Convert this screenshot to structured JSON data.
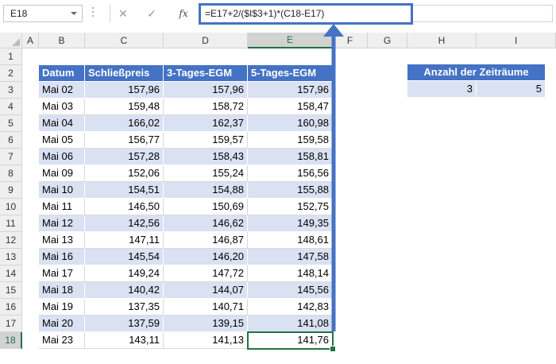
{
  "namebox": {
    "value": "E18"
  },
  "formula_bar": {
    "cancel_icon": "✕",
    "enter_icon": "✓",
    "fx_label": "fx",
    "formula": "=E17+2/($I$3+1)*(C18-E17)"
  },
  "columns": [
    "A",
    "B",
    "C",
    "D",
    "E",
    "F",
    "G",
    "H",
    "I"
  ],
  "rows": [
    "1",
    "2",
    "3",
    "4",
    "5",
    "6",
    "7",
    "8",
    "9",
    "10",
    "11",
    "12",
    "13",
    "14",
    "15",
    "16",
    "17",
    "18"
  ],
  "table": {
    "headers": [
      "Datum",
      "Schließpreis",
      "3-Tages-EGM",
      "5-Tages-EGM"
    ],
    "rows": [
      [
        "Mai 02",
        "157,96",
        "157,96",
        "157,96"
      ],
      [
        "Mai 03",
        "159,48",
        "158,72",
        "158,47"
      ],
      [
        "Mai 04",
        "166,02",
        "162,37",
        "160,98"
      ],
      [
        "Mai 05",
        "156,77",
        "159,57",
        "159,58"
      ],
      [
        "Mai 06",
        "157,28",
        "158,43",
        "158,81"
      ],
      [
        "Mai 09",
        "152,06",
        "155,24",
        "156,56"
      ],
      [
        "Mai 10",
        "154,51",
        "154,88",
        "155,88"
      ],
      [
        "Mai 11",
        "146,50",
        "150,69",
        "152,75"
      ],
      [
        "Mai 12",
        "142,56",
        "146,62",
        "149,35"
      ],
      [
        "Mai 13",
        "147,11",
        "146,87",
        "148,61"
      ],
      [
        "Mai 16",
        "145,54",
        "146,20",
        "147,58"
      ],
      [
        "Mai 17",
        "149,24",
        "147,72",
        "148,14"
      ],
      [
        "Mai 18",
        "140,42",
        "144,07",
        "145,56"
      ],
      [
        "Mai 19",
        "137,35",
        "140,71",
        "142,83"
      ],
      [
        "Mai 20",
        "137,59",
        "139,15",
        "141,08"
      ],
      [
        "Mai 23",
        "143,11",
        "141,13",
        "141,76"
      ]
    ]
  },
  "periods": {
    "header": "Anzahl der Zeiträume",
    "values": [
      "3",
      "5"
    ]
  },
  "selection": {
    "cell": "E18",
    "column": "E",
    "row": "18"
  },
  "colors": {
    "header_blue": "#4472c4",
    "band_blue": "#d9e1f2",
    "excel_green": "#217346",
    "callout_blue": "#4472c4"
  }
}
